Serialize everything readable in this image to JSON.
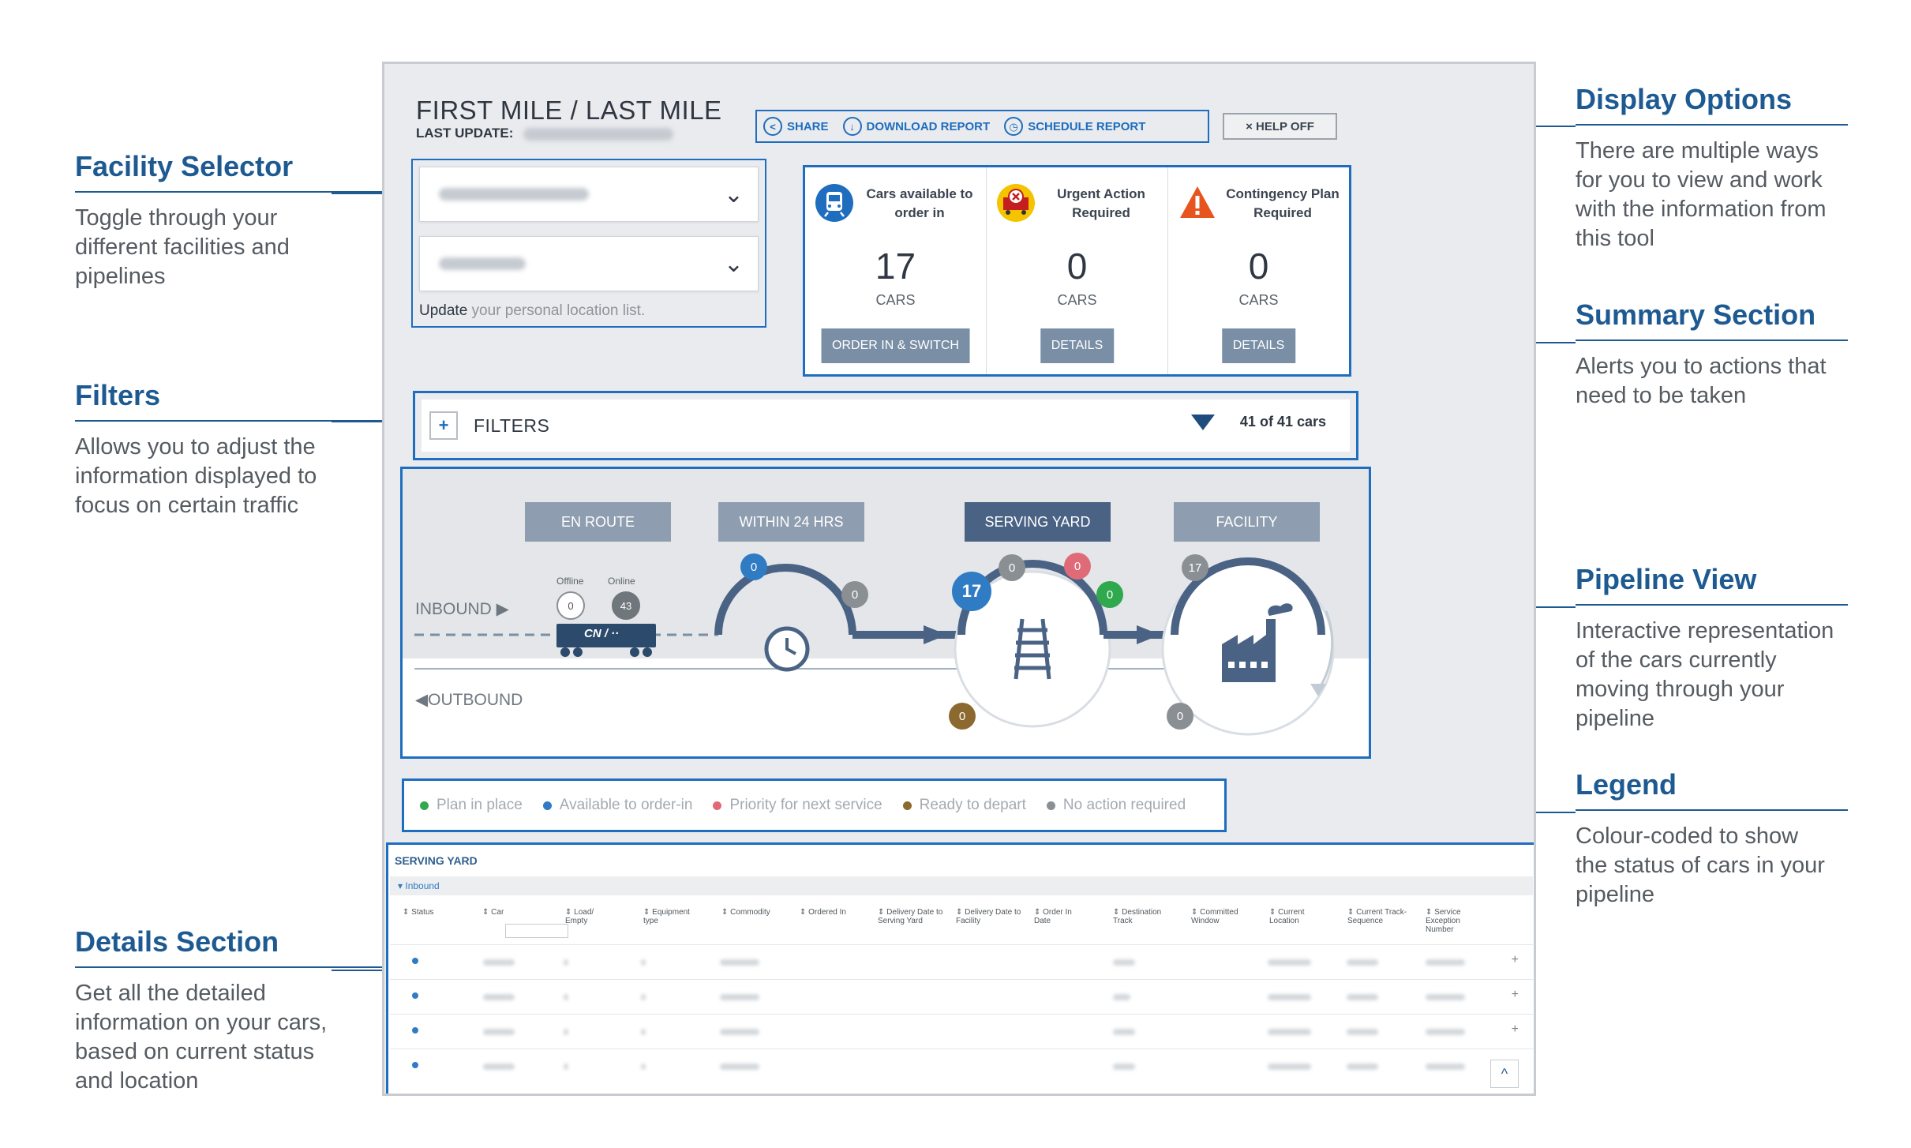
{
  "header": {
    "title": "FIRST MILE / LAST MILE",
    "last_update_label": "LAST UPDATE:"
  },
  "toolbar": {
    "share": "SHARE",
    "download": "DOWNLOAD REPORT",
    "schedule": "SCHEDULE REPORT",
    "help": "× HELP OFF"
  },
  "facility": {
    "note_link": "Update",
    "note_rest": " your personal location list."
  },
  "summary": [
    {
      "label": "Cars available to order in",
      "value": "17",
      "unit": "CARS",
      "button": "ORDER IN & SWITCH",
      "icon": "train-icon"
    },
    {
      "label": "Urgent Action Required",
      "value": "0",
      "unit": "CARS",
      "button": "DETAILS",
      "icon": "urgent-railcar-icon"
    },
    {
      "label": "Contingency Plan Required",
      "value": "0",
      "unit": "CARS",
      "button": "DETAILS",
      "icon": "warning-icon"
    }
  ],
  "filters": {
    "label": "FILTERS",
    "count": "41 of 41 cars"
  },
  "pipeline": {
    "stages": [
      "EN ROUTE",
      "WITHIN 24 HRS",
      "SERVING YARD",
      "FACILITY"
    ],
    "active_stage": "SERVING YARD",
    "inbound": "INBOUND ▶",
    "outbound": "◀OUTBOUND",
    "offline_label": "Offline",
    "online_label": "Online",
    "offline_count": "0",
    "online_count": "43",
    "railcar_text": "CN / ··",
    "badges": {
      "within24_blue": "0",
      "within24_grey": "0",
      "yard_blue": "17",
      "yard_grey": "0",
      "yard_red": "0",
      "yard_green": "0",
      "yard_brown": "0",
      "facility_grey": "17",
      "facility_out_grey": "0"
    }
  },
  "legend": [
    {
      "label": "Plan in place",
      "color": "#30a84e"
    },
    {
      "label": "Available to order-in",
      "color": "#2f7bc4"
    },
    {
      "label": "Priority for next service",
      "color": "#e06b78"
    },
    {
      "label": "Ready to depart",
      "color": "#8c6a2f"
    },
    {
      "label": "No action required",
      "color": "#8a8f94"
    }
  ],
  "details": {
    "title": "SERVING YARD",
    "group": "▾ Inbound",
    "columns": [
      "⇕ Status",
      "⇕ Car",
      "⇕ Load/ Empty",
      "⇕ Equipment type",
      "⇕ Commodity",
      "⇕ Ordered In",
      "⇕ Delivery Date to Serving Yard",
      "⇕ Delivery Date to Facility",
      "⇕ Order In Date",
      "⇕ Destination Track",
      "⇕ Committed Window",
      "⇕ Current Location",
      "⇕ Current Track-Sequence",
      "⇕ Service Exception Number"
    ],
    "row_action": "+",
    "scroll_top": "^"
  },
  "annotations": {
    "facility_selector": {
      "title": "Facility Selector",
      "body": "Toggle through your different facilities and pipelines"
    },
    "filters": {
      "title": "Filters",
      "body": "Allows you to adjust the information displayed to focus on certain traffic"
    },
    "details": {
      "title": "Details Section",
      "body": "Get all the detailed information on your cars, based on current status and location"
    },
    "display_options": {
      "title": "Display Options",
      "body": "There are multiple ways for you to view and work with the information from this tool"
    },
    "summary": {
      "title": "Summary Section",
      "body": "Alerts you to actions that need to be taken"
    },
    "pipeline": {
      "title": "Pipeline View",
      "body": "Interactive representation of the cars currently moving through your pipeline"
    },
    "legend": {
      "title": "Legend",
      "body": "Colour-coded to show the status of cars in your pipeline"
    }
  },
  "colors": {
    "accent": "#1e6dbf",
    "annotation": "#1e5a92",
    "active_stage": "#4a6384",
    "stage": "#8e9db0"
  }
}
